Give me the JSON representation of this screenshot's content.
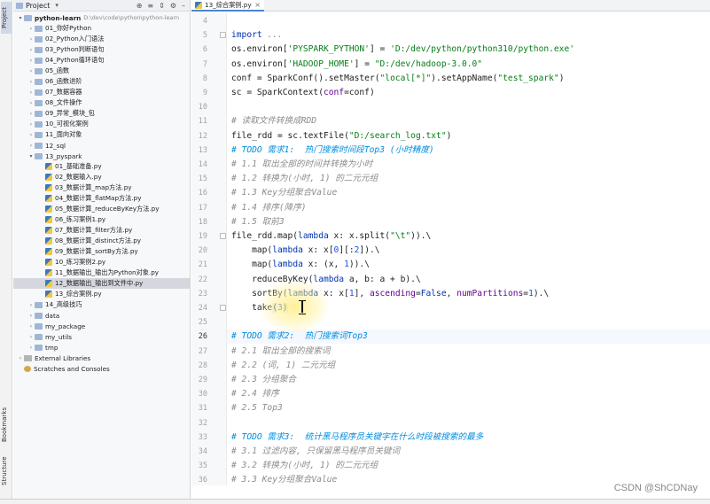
{
  "sidebar_tabs": {
    "project": "Project",
    "bookmarks": "Bookmarks",
    "structure": "Structure"
  },
  "project_panel": {
    "title": "Project",
    "tree": [
      {
        "label": "python-learn",
        "path": "D:\\dev\\code\\python\\python-learn",
        "depth": 0,
        "arrow": "down",
        "icon": "folder",
        "bold": true
      },
      {
        "label": "01_你好Python",
        "depth": 1,
        "arrow": "right",
        "icon": "folder"
      },
      {
        "label": "02_Python入门语法",
        "depth": 1,
        "arrow": "right",
        "icon": "folder"
      },
      {
        "label": "03_Python判断语句",
        "depth": 1,
        "arrow": "right",
        "icon": "folder"
      },
      {
        "label": "04_Python循环语句",
        "depth": 1,
        "arrow": "right",
        "icon": "folder"
      },
      {
        "label": "05_函数",
        "depth": 1,
        "arrow": "right",
        "icon": "folder"
      },
      {
        "label": "06_函数进阶",
        "depth": 1,
        "arrow": "right",
        "icon": "folder"
      },
      {
        "label": "07_数据容器",
        "depth": 1,
        "arrow": "right",
        "icon": "folder"
      },
      {
        "label": "08_文件操作",
        "depth": 1,
        "arrow": "right",
        "icon": "folder"
      },
      {
        "label": "09_异常_模块_包",
        "depth": 1,
        "arrow": "right",
        "icon": "folder"
      },
      {
        "label": "10_可视化案例",
        "depth": 1,
        "arrow": "right",
        "icon": "folder"
      },
      {
        "label": "11_面向对象",
        "depth": 1,
        "arrow": "right",
        "icon": "folder"
      },
      {
        "label": "12_sql",
        "depth": 1,
        "arrow": "right",
        "icon": "folder"
      },
      {
        "label": "13_pyspark",
        "depth": 1,
        "arrow": "down",
        "icon": "folder"
      },
      {
        "label": "01_基础准备.py",
        "depth": 2,
        "arrow": "",
        "icon": "pyfile"
      },
      {
        "label": "02_数据输入.py",
        "depth": 2,
        "arrow": "",
        "icon": "pyfile"
      },
      {
        "label": "03_数据计算_map方法.py",
        "depth": 2,
        "arrow": "",
        "icon": "pyfile"
      },
      {
        "label": "04_数据计算_flatMap方法.py",
        "depth": 2,
        "arrow": "",
        "icon": "pyfile"
      },
      {
        "label": "05_数据计算_reduceByKey方法.py",
        "depth": 2,
        "arrow": "",
        "icon": "pyfile"
      },
      {
        "label": "06_练习案例1.py",
        "depth": 2,
        "arrow": "",
        "icon": "pyfile"
      },
      {
        "label": "07_数据计算_filter方法.py",
        "depth": 2,
        "arrow": "",
        "icon": "pyfile"
      },
      {
        "label": "08_数据计算_distinct方法.py",
        "depth": 2,
        "arrow": "",
        "icon": "pyfile"
      },
      {
        "label": "09_数据计算_sortBy方法.py",
        "depth": 2,
        "arrow": "",
        "icon": "pyfile"
      },
      {
        "label": "10_练习案例2.py",
        "depth": 2,
        "arrow": "",
        "icon": "pyfile"
      },
      {
        "label": "11_数据输出_输出为Python对象.py",
        "depth": 2,
        "arrow": "",
        "icon": "pyfile"
      },
      {
        "label": "12_数据输出_输出到文件中.py",
        "depth": 2,
        "arrow": "",
        "icon": "pyfile",
        "selected": true
      },
      {
        "label": "13_综合案例.py",
        "depth": 2,
        "arrow": "",
        "icon": "pyfile"
      },
      {
        "label": "14_高级技巧",
        "depth": 1,
        "arrow": "right",
        "icon": "folder"
      },
      {
        "label": "data",
        "depth": 1,
        "arrow": "right",
        "icon": "folder"
      },
      {
        "label": "my_package",
        "depth": 1,
        "arrow": "right",
        "icon": "folder"
      },
      {
        "label": "my_utils",
        "depth": 1,
        "arrow": "right",
        "icon": "folder"
      },
      {
        "label": "tmp",
        "depth": 1,
        "arrow": "right",
        "icon": "folder"
      },
      {
        "label": "External Libraries",
        "depth": 0,
        "arrow": "right",
        "icon": "lib"
      },
      {
        "label": "Scratches and Consoles",
        "depth": 0,
        "arrow": "",
        "icon": "scratch"
      }
    ]
  },
  "editor": {
    "tab_label": "13_综合案例.py",
    "current_line": 26,
    "lines": [
      {
        "no": "4",
        "html": ""
      },
      {
        "no": "5",
        "html": "<span class=\"kw\">import</span> <span class=\"cmt\">...</span>"
      },
      {
        "no": "6",
        "html": "os.environ[<span class=\"str\">'PYSPARK_PYTHON'</span>] = <span class=\"str\">'D:/dev/python/python310/python.exe'</span>"
      },
      {
        "no": "7",
        "html": "os.environ[<span class=\"str\">'HADOOP_HOME'</span>] = <span class=\"str\">\"D:/dev/hadoop-3.0.0\"</span>"
      },
      {
        "no": "8",
        "html": "conf = SparkConf().setMaster(<span class=\"str\">\"local[*]\"</span>).setAppName(<span class=\"str\">\"test_spark\"</span>)"
      },
      {
        "no": "9",
        "html": "sc = SparkContext(<span class=\"param\">conf</span>=conf)"
      },
      {
        "no": "10",
        "html": ""
      },
      {
        "no": "11",
        "html": "<span class=\"cmt\"># 读取文件转换成RDD</span>"
      },
      {
        "no": "12",
        "html": "file_rdd = sc.textFile(<span class=\"str\">\"D:/search_log.txt\"</span>)"
      },
      {
        "no": "13",
        "html": "<span class=\"todo\"># TODO 需求1:  热门搜索时间段Top3 (小时精度)</span>"
      },
      {
        "no": "14",
        "html": "<span class=\"cmt\"># 1.1 取出全部的时间并转换为小时</span>"
      },
      {
        "no": "15",
        "html": "<span class=\"cmt\"># 1.2 转换为(小时, 1) 的二元元组</span>"
      },
      {
        "no": "16",
        "html": "<span class=\"cmt\"># 1.3 Key分组聚合Value</span>"
      },
      {
        "no": "17",
        "html": "<span class=\"cmt\"># 1.4 排序(降序)</span>"
      },
      {
        "no": "18",
        "html": "<span class=\"cmt\"># 1.5 取前3</span>"
      },
      {
        "no": "19",
        "html": "file_rdd.map(<span class=\"kw\">lambda</span> x: x.split(<span class=\"str\">\"\\t\"</span>)).\\"
      },
      {
        "no": "20",
        "html": "    map(<span class=\"kw\">lambda</span> x: x[<span class=\"num\">0</span>][:<span class=\"num\">2</span>]).\\"
      },
      {
        "no": "21",
        "html": "    map(<span class=\"kw\">lambda</span> x: (x, <span class=\"num\">1</span>)).\\"
      },
      {
        "no": "22",
        "html": "    reduceByKey(<span class=\"kw\">lambda</span> a, b: a + b).\\"
      },
      {
        "no": "23",
        "html": "    sortBy(<span class=\"kw\">lambda</span> x: x[<span class=\"num\">1</span>], <span class=\"param\">ascending</span>=<span class=\"kw\">False</span>, <span class=\"param\">numPartitions</span>=<span class=\"num\">1</span>).\\"
      },
      {
        "no": "24",
        "html": "    take<span class=\"hl\">(</span><span class=\"num\">3</span><span class=\"hl\">)</span>"
      },
      {
        "no": "25",
        "html": ""
      },
      {
        "no": "26",
        "html": "<span class=\"todo\"># TODO 需求2:  热门搜索词Top3</span>"
      },
      {
        "no": "27",
        "html": "<span class=\"cmt\"># 2.1 取出全部的搜索词</span>"
      },
      {
        "no": "28",
        "html": "<span class=\"cmt\"># 2.2 (词, 1) 二元元组</span>"
      },
      {
        "no": "29",
        "html": "<span class=\"cmt\"># 2.3 分组聚合</span>"
      },
      {
        "no": "30",
        "html": "<span class=\"cmt\"># 2.4 排序</span>"
      },
      {
        "no": "31",
        "html": "<span class=\"cmt\"># 2.5 Top3</span>"
      },
      {
        "no": "32",
        "html": ""
      },
      {
        "no": "33",
        "html": "<span class=\"todo\"># TODO 需求3:  统计黑马程序员关键字在什么时段被搜索的最多</span>"
      },
      {
        "no": "34",
        "html": "<span class=\"cmt\"># 3.1 过滤内容, 只保留黑马程序员关键词</span>"
      },
      {
        "no": "35",
        "html": "<span class=\"cmt\"># 3.2 转换为(小时, 1) 的二元元组</span>"
      },
      {
        "no": "36",
        "html": "<span class=\"cmt\"># 3.3 Key分组聚合Value</span>"
      }
    ]
  },
  "watermark": "CSDN @ShCDNay"
}
